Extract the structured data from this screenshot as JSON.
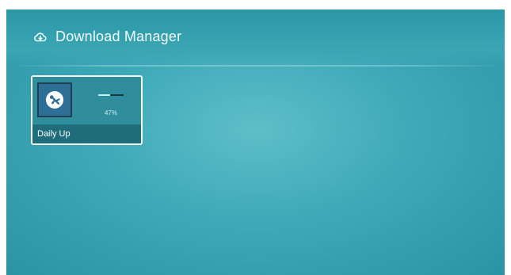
{
  "header": {
    "title": "Download Manager",
    "icon": "cloud-download-icon"
  },
  "downloads": [
    {
      "name": "Daily Up",
      "icon": "app-person-icon",
      "progress_percent": 47,
      "progress_label": "47%"
    }
  ],
  "colors": {
    "accent": "#3aa6b4",
    "tile_background": "#2f8d9c",
    "progress_fill": "#bff3f7"
  }
}
